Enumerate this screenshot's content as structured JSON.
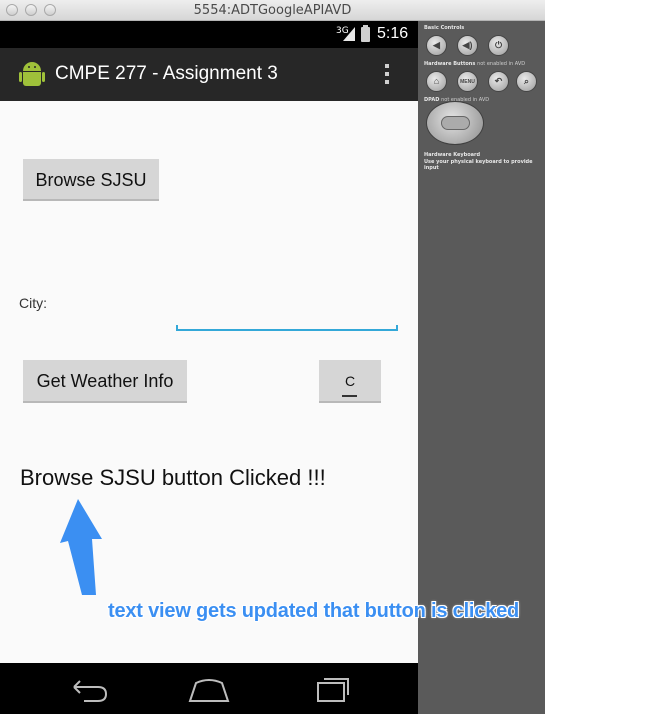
{
  "window": {
    "title": "5554:ADTGoogleAPIAVD"
  },
  "statusbar": {
    "network": "3G",
    "time": "5:16"
  },
  "actionbar": {
    "title": "CMPE 277 - Assignment 3",
    "icon": "android-icon"
  },
  "buttons": {
    "browse_label": "Browse SJSU",
    "weather_label": "Get Weather Info",
    "c_label": "C"
  },
  "form": {
    "city_label": "City:",
    "city_value": ""
  },
  "message": "Browse SJSU button Clicked !!!",
  "annotation": "text view gets updated that button is clicked",
  "colors": {
    "accent": "#33a8d8",
    "annotation": "#3b8ff2",
    "actionbar": "#272727",
    "panel": "#5a5a5a",
    "android_green": "#9fc13a"
  },
  "side_panel": {
    "basic_controls": "Basic Controls",
    "hardware_buttons": "Hardware Buttons",
    "hardware_buttons_note": "not enabled in AVD",
    "menu_label": "MENU",
    "dpad": "DPAD",
    "dpad_note": "not enabled in AVD",
    "keyboard": "Hardware Keyboard",
    "keyboard_note": "Use your physical keyboard to provide input"
  }
}
